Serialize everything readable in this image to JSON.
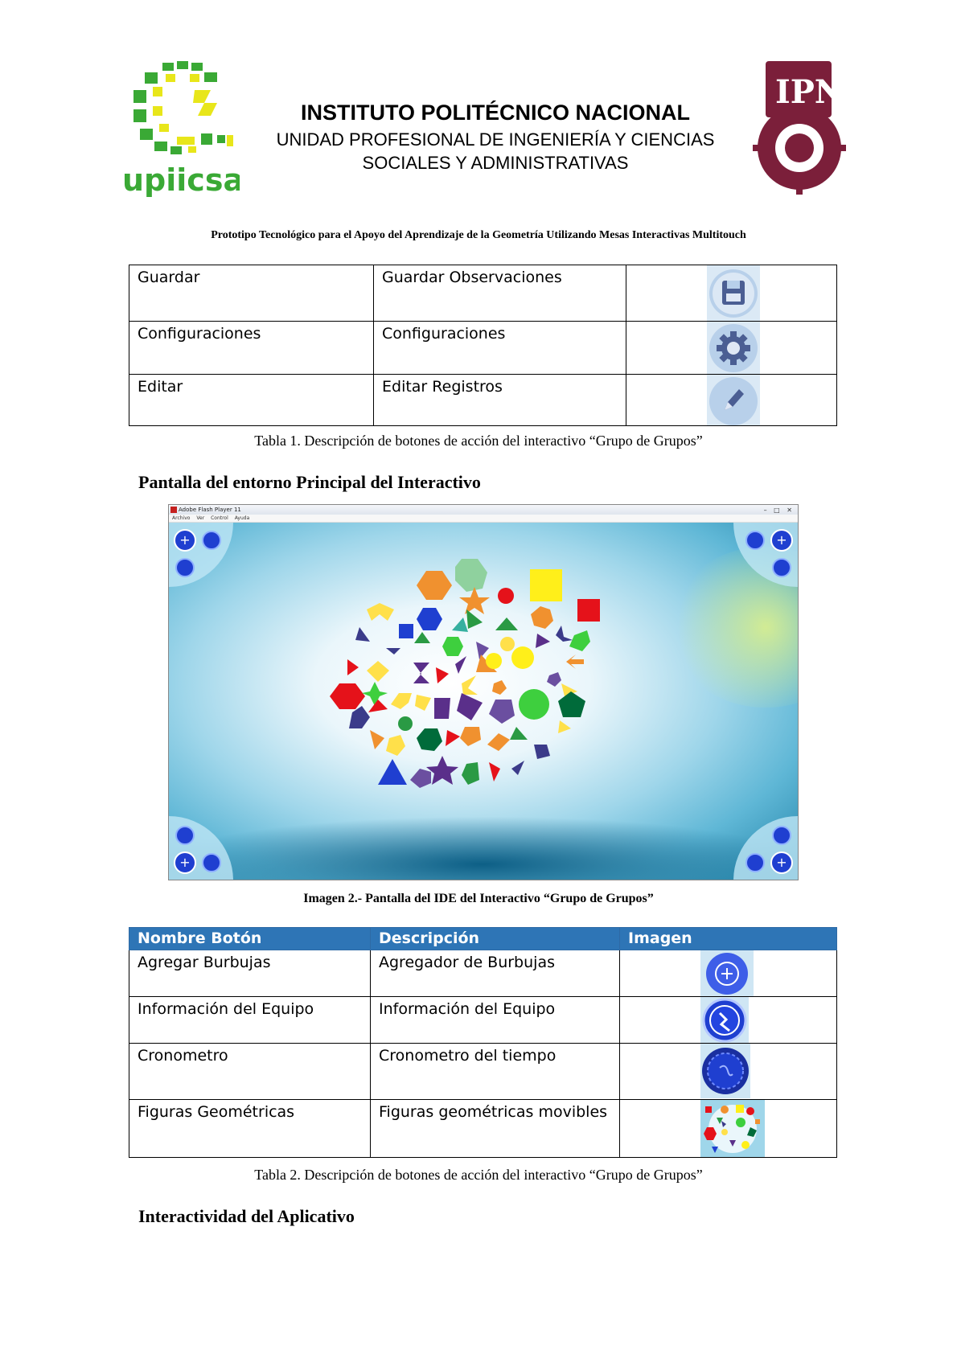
{
  "header": {
    "institute": "INSTITUTO POLITÉCNICO NACIONAL",
    "unit_line1": "UNIDAD PROFESIONAL DE INGENIERÍA Y CIENCIAS",
    "unit_line2": "SOCIALES Y ADMINISTRATIVAS",
    "left_logo_text": "upiicsa",
    "right_logo_text": "IPN"
  },
  "doc_subtitle": "Prototipo Tecnológico para el Apoyo del Aprendizaje de la Geometría Utilizando Mesas Interactivas Multitouch",
  "table1": {
    "rows": [
      {
        "name": "Guardar",
        "description": "Guardar Observaciones",
        "icon": "save-icon"
      },
      {
        "name": "Configuraciones",
        "description": "Configuraciones",
        "icon": "gear-icon"
      },
      {
        "name": "Editar",
        "description": "Editar Registros",
        "icon": "pencil-icon"
      }
    ],
    "caption": "Tabla 1. Descripción de botones de acción del interactivo “Grupo de Grupos”"
  },
  "section1_heading": "Pantalla del entorno Principal del Interactivo",
  "screenshot": {
    "window_title": "Adobe Flash Player 11",
    "menu": [
      "Archivo",
      "Ver",
      "Control",
      "Ayuda"
    ],
    "caption": "Imagen 2.- Pantalla del IDE del Interactivo “Grupo de Grupos”"
  },
  "table2": {
    "headers": [
      "Nombre Botón",
      "Descripción",
      "Imagen"
    ],
    "rows": [
      {
        "name": "Agregar Burbujas",
        "description": "Agregador de Burbujas",
        "icon": "add-bubble-icon"
      },
      {
        "name": "Información del Equipo",
        "description": "Información del Equipo",
        "icon": "info-icon"
      },
      {
        "name": "Cronometro",
        "description": "Cronometro del tiempo",
        "icon": "stopwatch-icon"
      },
      {
        "name": "Figuras Geométricas",
        "description": "Figuras geométricas movibles",
        "icon": "shapes-thumbnail-icon"
      }
    ],
    "caption": "Tabla 2. Descripción de botones de acción del interactivo “Grupo de Grupos”"
  },
  "section2_heading": "Interactividad del Aplicativo",
  "colors": {
    "table_header": "#2e75b6",
    "logo_green": "#3aa935",
    "logo_yellow": "#e8e61a",
    "ipn_maroon": "#7b1f3a"
  }
}
